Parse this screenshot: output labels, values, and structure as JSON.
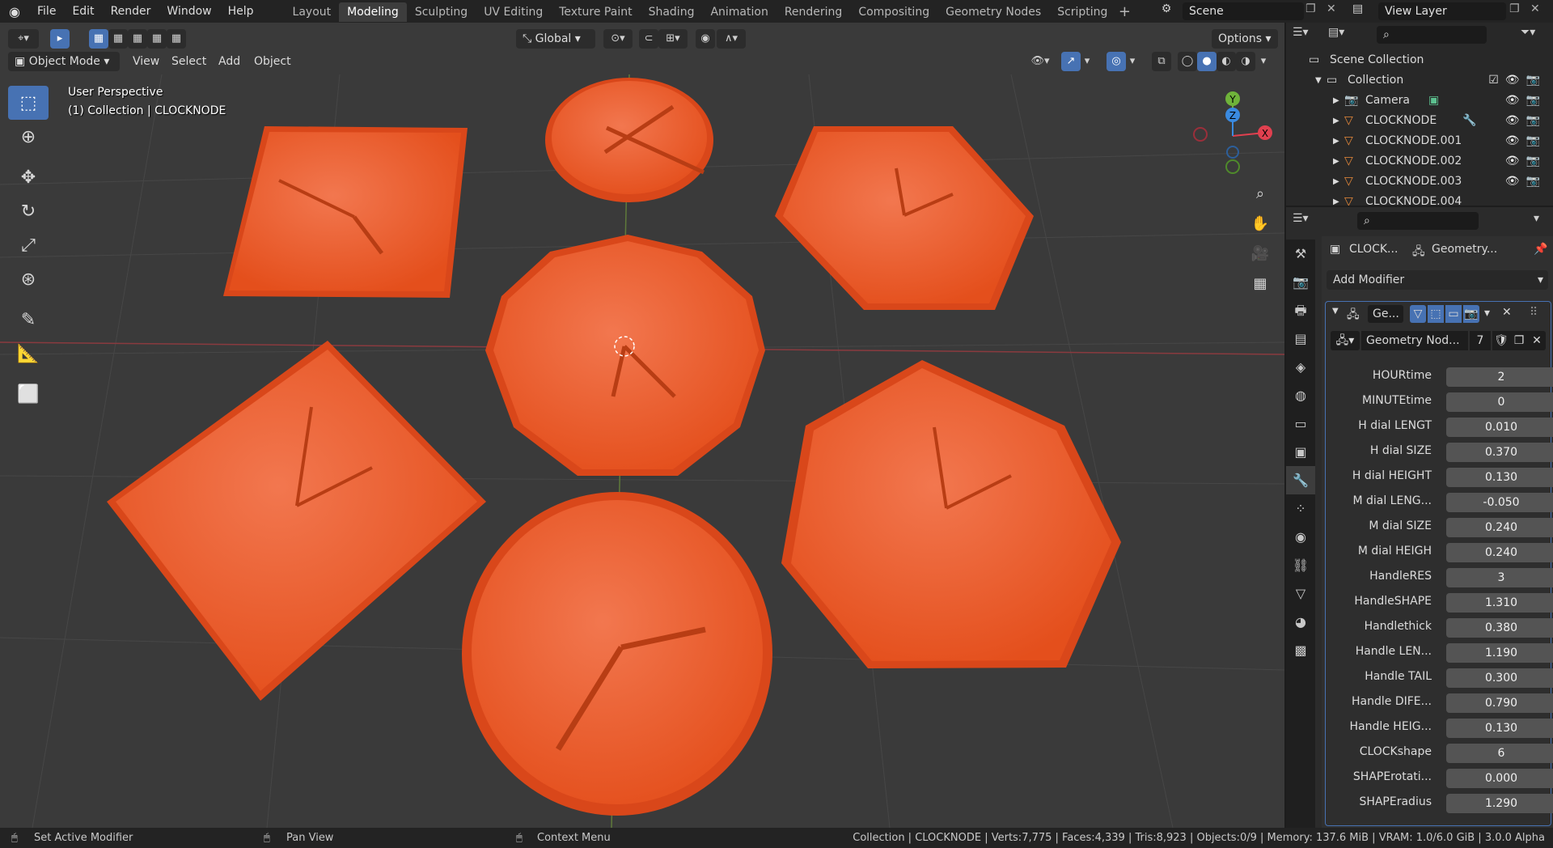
{
  "topbar": {
    "menus": [
      "File",
      "Edit",
      "Render",
      "Window",
      "Help"
    ],
    "workspaces": [
      "Layout",
      "Modeling",
      "Sculpting",
      "UV Editing",
      "Texture Paint",
      "Shading",
      "Animation",
      "Rendering",
      "Compositing",
      "Geometry Nodes",
      "Scripting"
    ],
    "active_workspace": "Modeling",
    "scene": "Scene",
    "view_layer": "View Layer"
  },
  "viewport": {
    "mode": "Object Mode",
    "menus": [
      "View",
      "Select",
      "Add",
      "Object"
    ],
    "transform_orientation": "Global",
    "options_label": "Options",
    "perspective_label": "User Perspective",
    "collection_label": "(1) Collection | CLOCKNODE",
    "gizmo_axes": {
      "x": "X",
      "y": "Y",
      "z": "Z"
    },
    "object_color": "#e8501e"
  },
  "outliner": {
    "root": "Scene Collection",
    "collection": "Collection",
    "items": [
      "Camera",
      "CLOCKNODE",
      "CLOCKNODE.001",
      "CLOCKNODE.002",
      "CLOCKNODE.003",
      "CLOCKNODE.004"
    ]
  },
  "properties": {
    "object_name": "CLOCK...",
    "modifier_name_header": "Geometry...",
    "add_modifier": "Add Modifier",
    "modifier_short": "Ge...",
    "node_group": "Geometry Nod...",
    "node_users": "7",
    "params": [
      {
        "label": "HOURtime",
        "value": "2"
      },
      {
        "label": "MINUTEtime",
        "value": "0"
      },
      {
        "label": "H dial LENGT",
        "value": "0.010"
      },
      {
        "label": "H dial SIZE",
        "value": "0.370"
      },
      {
        "label": "H dial HEIGHT",
        "value": "0.130"
      },
      {
        "label": "M dial LENG...",
        "value": "-0.050"
      },
      {
        "label": "M dial SIZE",
        "value": "0.240"
      },
      {
        "label": "M dial HEIGH",
        "value": "0.240"
      },
      {
        "label": "HandleRES",
        "value": "3"
      },
      {
        "label": "HandleSHAPE",
        "value": "1.310"
      },
      {
        "label": "Handlethick",
        "value": "0.380"
      },
      {
        "label": "Handle LEN...",
        "value": "1.190"
      },
      {
        "label": "Handle TAIL",
        "value": "0.300"
      },
      {
        "label": "Handle DIFE...",
        "value": "0.790"
      },
      {
        "label": "Handle HEIG...",
        "value": "0.130"
      },
      {
        "label": "CLOCKshape",
        "value": "6"
      },
      {
        "label": "SHAPErotati...",
        "value": "0.000"
      },
      {
        "label": "SHAPEradius",
        "value": "1.290"
      }
    ]
  },
  "statusbar": {
    "left1": "Set Active Modifier",
    "left2": "Pan View",
    "left3": "Context Menu",
    "stats": "Collection | CLOCKNODE | Verts:7,775 | Faces:4,339 | Tris:8,923 | Objects:0/9 | Memory: 137.6 MiB | VRAM: 1.0/6.0 GiB | 3.0.0 Alpha"
  }
}
